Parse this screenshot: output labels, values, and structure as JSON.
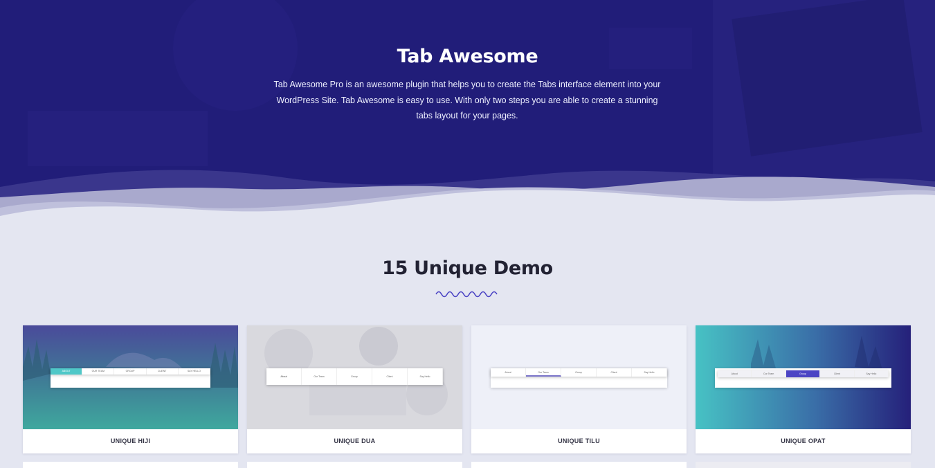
{
  "hero": {
    "title": "Tab Awesome",
    "description": "Tab Awesome Pro is an awesome plugin that helps you to create the Tabs interface element into your WordPress Site. Tab Awesome is easy to use. With only two steps you are able to create a stunning tabs layout for your pages."
  },
  "demos": {
    "title": "15 Unique Demo",
    "cards": [
      {
        "label": "UNIQUE HIJI",
        "tabs": [
          "ABOUT",
          "OUR TEAM",
          "GROUP",
          "CLIENT",
          "SAY HELLO"
        ]
      },
      {
        "label": "UNIQUE DUA",
        "tabs": [
          "About",
          "Our Team",
          "Group",
          "Client",
          "Say Hello"
        ]
      },
      {
        "label": "UNIQUE TILU",
        "tabs": [
          "About",
          "Our Team",
          "Group",
          "Client",
          "Say Hello"
        ]
      },
      {
        "label": "UNIQUE OPAT",
        "tabs": [
          "About",
          "Our Team",
          "Group",
          "Client",
          "Say Hello"
        ]
      }
    ]
  },
  "colors": {
    "hero_bg": "#211d79",
    "page_bg": "#e4e6f1",
    "accent_teal": "#4fc8c8",
    "accent_purple": "#4b44c4"
  }
}
